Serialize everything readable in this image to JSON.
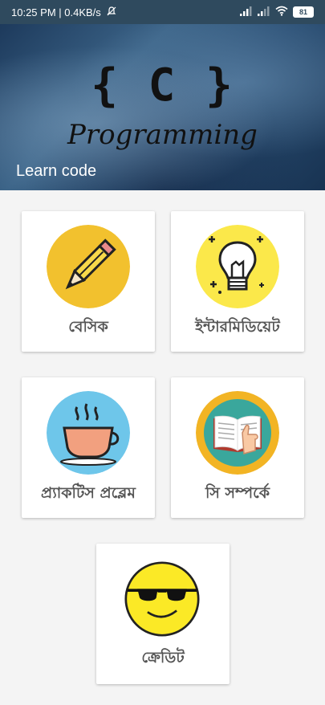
{
  "status_bar": {
    "time_speed": "10:25 PM | 0.4KB/s",
    "battery": "81",
    "icons": [
      "mute-bell-icon",
      "signal-icon",
      "signal-icon",
      "wifi-icon",
      "battery-icon"
    ]
  },
  "hero": {
    "brace_text": "{ C }",
    "title": "Programming",
    "tagline": "Learn code"
  },
  "cards": [
    {
      "label": "বেসিক",
      "icon": "pencil-icon",
      "color": "#f2c12e"
    },
    {
      "label": "ইন্টারমিডিয়েট",
      "icon": "lightbulb-icon",
      "color": "#fbe84a"
    },
    {
      "label": "প্র্যাকটিস প্রব্লেম",
      "icon": "coffee-cup-icon",
      "color": "#6ec6ea"
    },
    {
      "label": "সি সম্পর্কে",
      "icon": "book-icon",
      "color": "#f2b424"
    },
    {
      "label": "ক্রেডিট",
      "icon": "sunglasses-smiley-icon",
      "color": "#fbe926"
    }
  ]
}
